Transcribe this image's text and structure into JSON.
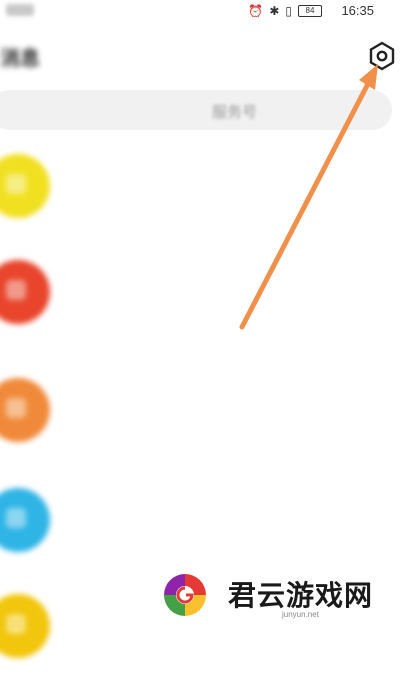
{
  "status_bar": {
    "time": "16:35",
    "battery": "84",
    "icons": [
      "alarm-icon",
      "bluetooth-icon",
      "vibrate-icon",
      "battery-icon"
    ]
  },
  "header": {
    "title": "消息",
    "subtitle": "",
    "settings_icon": "gear-icon"
  },
  "search": {
    "placeholder": "服务号"
  },
  "list": [
    {
      "title": "",
      "desc": "",
      "meta": "",
      "avatar_color": "#f1e020"
    },
    {
      "title": "",
      "desc": "",
      "meta": "",
      "avatar_color": "#e8452c"
    },
    {
      "title": "",
      "desc": "",
      "meta": "",
      "avatar_color": "#f08a3a"
    },
    {
      "title": "",
      "desc": "",
      "meta": "",
      "avatar_color": "#2fb4e6"
    },
    {
      "title": "",
      "desc": "",
      "meta": "",
      "avatar_color": "#f2c60c"
    }
  ],
  "annotation": {
    "arrow_color": "#f0904a"
  },
  "watermark": {
    "text": "君云游戏网",
    "domain": "junyun.net"
  }
}
